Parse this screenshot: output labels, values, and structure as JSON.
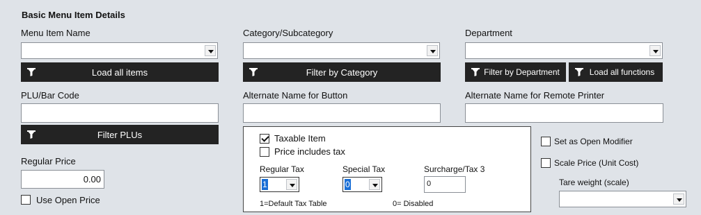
{
  "section_title": "Basic Menu Item Details",
  "menu_item": {
    "label": "Menu Item Name",
    "value": "",
    "button": "Load all items"
  },
  "category": {
    "label": "Category/Subcategory",
    "value": "",
    "button": "Filter by Category"
  },
  "department": {
    "label": "Department",
    "value": "",
    "button_filter": "Filter by Department",
    "button_load": "Load all functions"
  },
  "plu": {
    "label": "PLU/Bar Code",
    "value": "",
    "button": "Filter PLUs"
  },
  "alt_button": {
    "label": "Alternate Name for Button",
    "value": ""
  },
  "alt_printer": {
    "label": "Alternate Name for Remote Printer",
    "value": ""
  },
  "price": {
    "label": "Regular Price",
    "value": "0.00",
    "open_price_label": "Use Open Price",
    "open_price_checked": false
  },
  "tax_panel": {
    "taxable_label": "Taxable Item",
    "taxable_checked": true,
    "includes_tax_label": "Price includes tax",
    "includes_tax_checked": false,
    "regular_tax_label": "Regular Tax",
    "regular_tax_value": "1",
    "special_tax_label": "Special Tax",
    "special_tax_value": "0",
    "surcharge_label": "Surcharge/Tax 3",
    "surcharge_value": "0",
    "note_default": "1=Default Tax Table",
    "note_disabled": "0= Disabled"
  },
  "right_options": {
    "open_modifier_label": "Set as Open Modifier",
    "open_modifier_checked": false,
    "scale_price_label": "Scale Price (Unit Cost)",
    "scale_price_checked": false,
    "tare_label": "Tare weight (scale)",
    "tare_value": ""
  },
  "icons": {
    "filter": "filter-funnel-icon",
    "dropdown": "chevron-down-icon"
  }
}
